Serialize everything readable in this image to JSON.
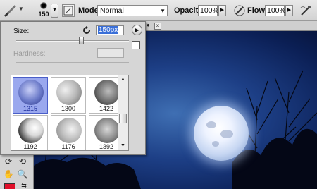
{
  "options_bar": {
    "brush_size": "150",
    "mode_label": "Mode:",
    "mode_value": "Normal",
    "opacity_label": "Opacity:",
    "opacity_value": "100%",
    "flow_label": "Flow:",
    "flow_value": "100%"
  },
  "brush_picker": {
    "size_label": "Size:",
    "size_value": "150px",
    "hardness_label": "Hardness:",
    "presets": [
      {
        "label": "1315",
        "selected": true
      },
      {
        "label": "1300",
        "selected": false
      },
      {
        "label": "1422",
        "selected": false
      },
      {
        "label": "1192",
        "selected": false
      },
      {
        "label": "1176",
        "selected": false
      },
      {
        "label": "1392",
        "selected": false
      }
    ]
  },
  "toolbox": {
    "foreground_color": "#e0102a"
  },
  "icons": [
    "brush-tool-icon",
    "brush-panel-toggle-icon",
    "airbrush-icon",
    "size-reset-icon",
    "panel-menu-icon",
    "new-preset-icon",
    "hand-icon",
    "zoom-icon",
    "lasso-icon"
  ]
}
